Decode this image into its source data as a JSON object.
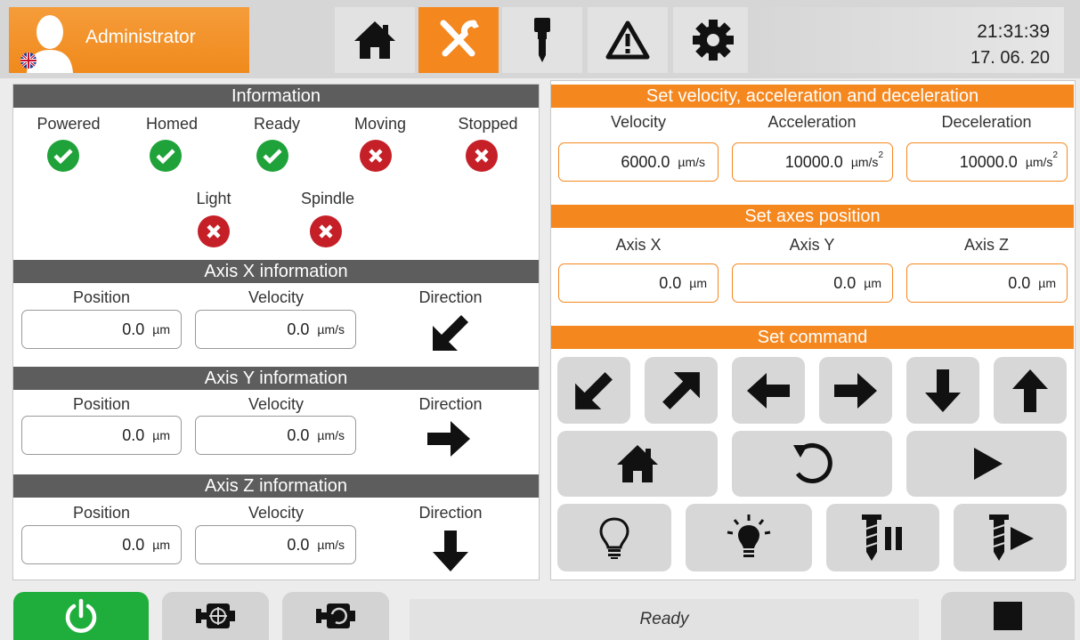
{
  "header": {
    "user": "Administrator",
    "time": "21:31:39",
    "date": "17. 06. 20",
    "tabs": [
      {
        "icon": "home-icon",
        "active": false
      },
      {
        "icon": "tools-icon",
        "active": true
      },
      {
        "icon": "spindle-icon",
        "active": false
      },
      {
        "icon": "warning-icon",
        "active": false
      },
      {
        "icon": "gear-icon",
        "active": false
      }
    ]
  },
  "info": {
    "title": "Information",
    "statuses": [
      {
        "label": "Powered",
        "state": "ok"
      },
      {
        "label": "Homed",
        "state": "ok"
      },
      {
        "label": "Ready",
        "state": "ok"
      },
      {
        "label": "Moving",
        "state": "error"
      },
      {
        "label": "Stopped",
        "state": "error"
      },
      {
        "label": "Light",
        "state": "error"
      },
      {
        "label": "Spindle",
        "state": "error"
      }
    ]
  },
  "axes": [
    {
      "title": "Axis X information",
      "position_label": "Position",
      "velocity_label": "Velocity",
      "direction_label": "Direction",
      "position": "0.0",
      "position_unit": "µm",
      "velocity": "0.0",
      "velocity_unit": "µm/s",
      "direction_icon": "arrow-down-left-icon"
    },
    {
      "title": "Axis Y information",
      "position_label": "Position",
      "velocity_label": "Velocity",
      "direction_label": "Direction",
      "position": "0.0",
      "position_unit": "µm",
      "velocity": "0.0",
      "velocity_unit": "µm/s",
      "direction_icon": "arrow-right-icon"
    },
    {
      "title": "Axis Z information",
      "position_label": "Position",
      "velocity_label": "Velocity",
      "direction_label": "Direction",
      "position": "0.0",
      "position_unit": "µm",
      "velocity": "0.0",
      "velocity_unit": "µm/s",
      "direction_icon": "arrow-down-icon"
    }
  ],
  "motion": {
    "title": "Set velocity, acceleration and deceleration",
    "velocity_label": "Velocity",
    "acceleration_label": "Acceleration",
    "deceleration_label": "Deceleration",
    "velocity": "6000.0",
    "velocity_unit": "µm/s",
    "acceleration": "10000.0",
    "acceleration_unit": "µm/s",
    "deceleration": "10000.0",
    "deceleration_unit": "µm/s",
    "exponent": "2"
  },
  "axes_position": {
    "title": "Set axes position",
    "x_label": "Axis X",
    "y_label": "Axis Y",
    "z_label": "Axis Z",
    "x": "0.0",
    "y": "0.0",
    "z": "0.0",
    "unit": "µm"
  },
  "command": {
    "title": "Set command",
    "buttons": [
      "arrow-down-left-icon",
      "arrow-up-right-icon",
      "arrow-left-icon",
      "arrow-right-icon",
      "arrow-down-icon",
      "arrow-up-icon",
      "home-icon",
      "reset-icon",
      "play-icon",
      "light-off-icon",
      "light-on-icon",
      "spindle-pause-icon",
      "spindle-play-icon"
    ]
  },
  "footer": {
    "status": "Ready",
    "buttons": [
      "power-icon",
      "motor-target-icon",
      "motor-rotate-icon",
      "stop-icon"
    ]
  },
  "colors": {
    "accent": "#f5871f",
    "ok": "#1fa23a",
    "error": "#c52028",
    "power": "#1fae3c"
  }
}
